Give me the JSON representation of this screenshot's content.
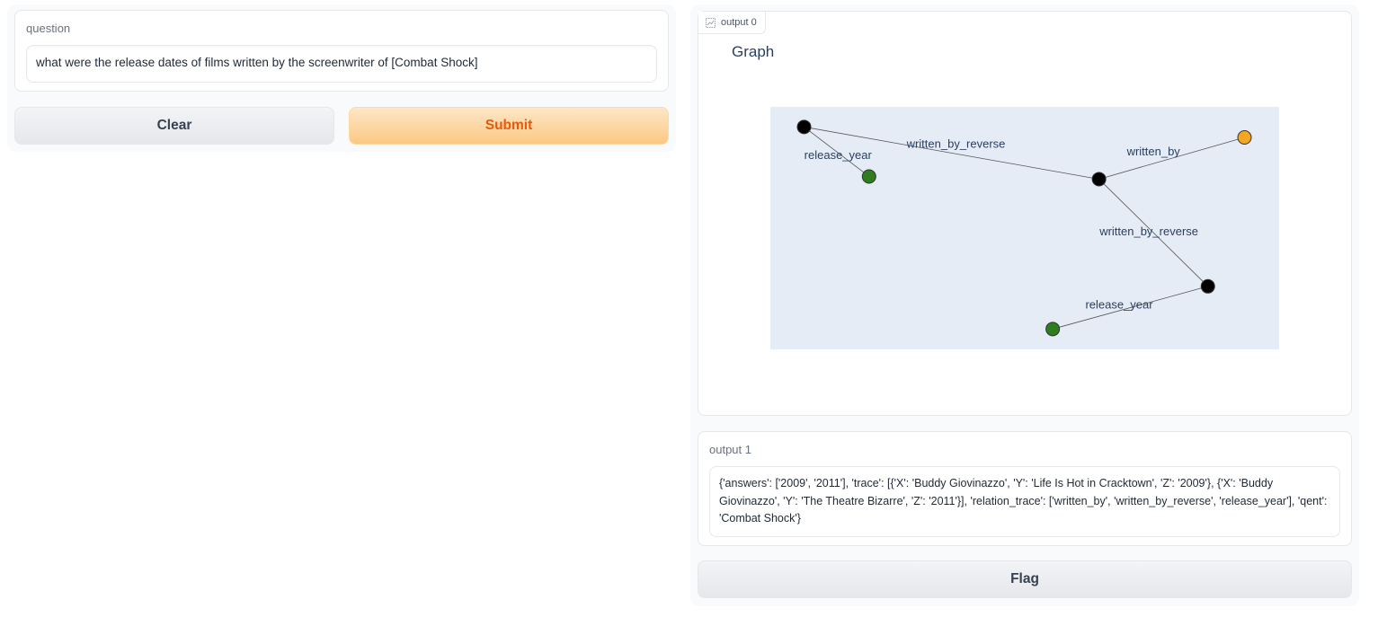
{
  "left": {
    "question_label": "question",
    "question_value": "what were the release dates of films written by the screenwriter of [Combat Shock]",
    "clear_label": "Clear",
    "submit_label": "Submit"
  },
  "right": {
    "output0_label": "output 0",
    "output0_icon": "chart-icon",
    "output1_label": "output 1",
    "output1_value": "{'answers': ['2009', '2011'], 'trace': [{'X': 'Buddy Giovinazzo', 'Y': 'Life Is Hot in Cracktown', 'Z': '2009'}, {'X': 'Buddy Giovinazzo', 'Y': 'The Theatre Bizarre', 'Z': '2011'}], 'relation_trace': ['written_by', 'written_by_reverse', 'release_year'], 'qent': 'Combat Shock'}",
    "flag_label": "Flag"
  },
  "chart_data": {
    "type": "network",
    "title": "Graph",
    "plot_bg": "#e5ecf6",
    "edge_color": "#555555",
    "node_colors": {
      "entity": "#000000",
      "topic": "#f5a623",
      "answer": "#2e7d1f"
    },
    "nodes": [
      {
        "id": "n1",
        "kind": "entity",
        "x": 0.0663,
        "y": 0.9173
      },
      {
        "id": "n2",
        "kind": "answer",
        "x": 0.194,
        "y": 0.713
      },
      {
        "id": "n3",
        "kind": "entity",
        "x": 0.646,
        "y": 0.702
      },
      {
        "id": "n4",
        "kind": "topic",
        "x": 0.932,
        "y": 0.874
      },
      {
        "id": "n5",
        "kind": "entity",
        "x": 0.86,
        "y": 0.26
      },
      {
        "id": "n6",
        "kind": "answer",
        "x": 0.555,
        "y": 0.084
      }
    ],
    "edges": [
      {
        "from": "n1",
        "to": "n2",
        "label": "release_year"
      },
      {
        "from": "n1",
        "to": "n3",
        "label": "written_by_reverse"
      },
      {
        "from": "n3",
        "to": "n4",
        "label": "written_by"
      },
      {
        "from": "n3",
        "to": "n5",
        "label": "written_by_reverse"
      },
      {
        "from": "n5",
        "to": "n6",
        "label": "release_year"
      }
    ]
  }
}
